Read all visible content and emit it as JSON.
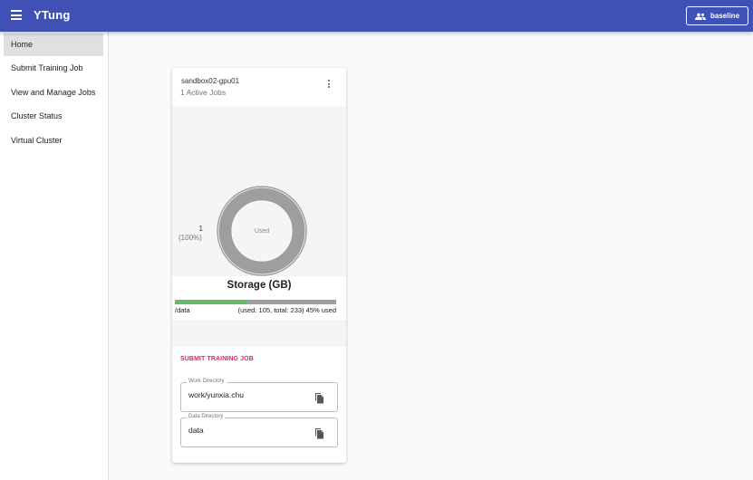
{
  "app": {
    "title": "YTung",
    "user_button": "baseline",
    "icons": {
      "menu": "menu-icon",
      "user": "group-icon"
    },
    "colors": {
      "primary": "#3f51b5",
      "accent": "#e91e63",
      "bar_used": "#66bb6a",
      "bar_free": "#9e9e9e",
      "donut": "#9e9e9e"
    }
  },
  "sidebar": {
    "items": [
      {
        "label": "Home",
        "active": true
      },
      {
        "label": "Submit Training Job",
        "active": false
      },
      {
        "label": "View and Manage Jobs",
        "active": false
      },
      {
        "label": "Cluster Status",
        "active": false
      },
      {
        "label": "Virtual Cluster",
        "active": false
      }
    ]
  },
  "card": {
    "host": "sandbox02-gpu01",
    "active_jobs": "1 Active Jobs",
    "chart": {
      "center_label": "Used",
      "legend_count": "1",
      "legend_percent": "(100%)",
      "used_fraction": 1.0
    },
    "storage": {
      "title": "Storage (GB)",
      "path": "/data",
      "info": "(used: 105, total: 233) 45% used",
      "used": 105,
      "total": 233,
      "used_percent": 45
    },
    "submit_label": "SUBMIT TRAINING JOB",
    "work_dir": {
      "label": "Work Directory",
      "value": "work/yunxia.chu"
    },
    "data_dir": {
      "label": "Data Directory",
      "value": "data"
    }
  }
}
